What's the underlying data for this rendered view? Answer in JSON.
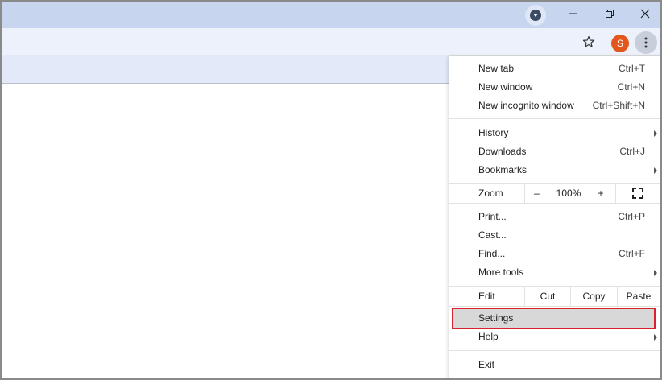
{
  "window": {
    "minimize": "–",
    "restore": "⧉",
    "close": "✕"
  },
  "toolbar": {
    "avatar_initial": "S"
  },
  "menu": {
    "new_tab": {
      "label": "New tab",
      "shortcut": "Ctrl+T"
    },
    "new_window": {
      "label": "New window",
      "shortcut": "Ctrl+N"
    },
    "new_incognito": {
      "label": "New incognito window",
      "shortcut": "Ctrl+Shift+N"
    },
    "history": {
      "label": "History"
    },
    "downloads": {
      "label": "Downloads",
      "shortcut": "Ctrl+J"
    },
    "bookmarks": {
      "label": "Bookmarks"
    },
    "zoom": {
      "label": "Zoom",
      "minus": "–",
      "value": "100%",
      "plus": "+"
    },
    "print": {
      "label": "Print...",
      "shortcut": "Ctrl+P"
    },
    "cast": {
      "label": "Cast..."
    },
    "find": {
      "label": "Find...",
      "shortcut": "Ctrl+F"
    },
    "more_tools": {
      "label": "More tools"
    },
    "edit": {
      "label": "Edit",
      "cut": "Cut",
      "copy": "Copy",
      "paste": "Paste"
    },
    "settings": {
      "label": "Settings"
    },
    "help": {
      "label": "Help"
    },
    "exit": {
      "label": "Exit"
    }
  },
  "colors": {
    "highlight_border": "#d6232f",
    "avatar": "#e2571e"
  }
}
